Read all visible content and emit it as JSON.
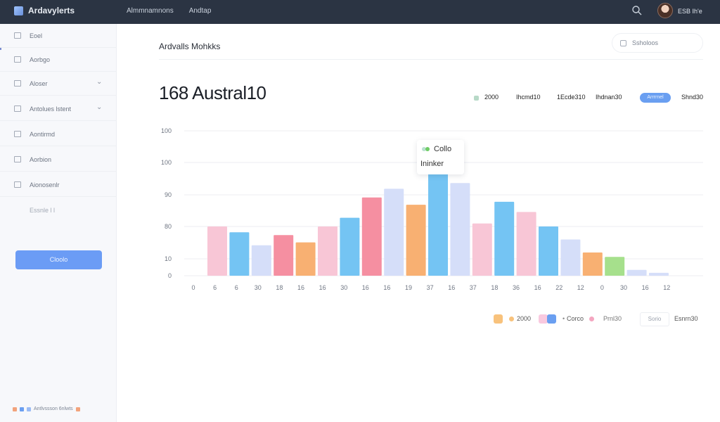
{
  "app": {
    "title": "Ardavylerts"
  },
  "topnav": {
    "items": [
      "Almmnamnons",
      "Andtap"
    ]
  },
  "user": {
    "name": "ESB Ih'e"
  },
  "sidebar": {
    "items": [
      {
        "label": "Eoel",
        "icon": "grid-icon",
        "chevron": false
      },
      {
        "label": "Aorbgo",
        "icon": "document-icon",
        "chevron": false
      },
      {
        "label": "Aloser",
        "icon": "bars-icon",
        "chevron": true
      },
      {
        "label": "Antolues lstent",
        "icon": "chart-icon",
        "chevron": true
      },
      {
        "label": "Aontirmd",
        "icon": "box-icon",
        "chevron": false
      },
      {
        "label": "Aorbion",
        "icon": "grid-icon",
        "chevron": false
      },
      {
        "label": "Aionosenlr",
        "icon": "layers-icon",
        "chevron": false
      }
    ],
    "note": "Essnle l l",
    "button_label": "Cloolo",
    "footer_label": "Antlvssson 6nlwts"
  },
  "main": {
    "section_title": "Ardvalls Mohkks",
    "filter_button": "Ssholoos",
    "headline": "168 Austral10"
  },
  "legend_top": {
    "items": [
      {
        "label": "2000",
        "color": "#b7d9c7"
      },
      {
        "label": "Ihcmd10",
        "color": "#2a2f38"
      },
      {
        "label": "1Ecde310",
        "color": "#ef8a4a"
      },
      {
        "label": "Ihdnan30",
        "color": "#e6587a"
      },
      {
        "label": "Arrrrnel",
        "color": "#6a9ff1"
      },
      {
        "label": "Shnd30",
        "color": "#4b5260"
      }
    ]
  },
  "tooltip": {
    "label": "Collo",
    "value": "Ininker"
  },
  "chart_data": {
    "type": "bar",
    "y_tick_labels": [
      "100",
      "100",
      "90",
      "80",
      "10",
      "0"
    ],
    "x_tick_labels": [
      "0",
      "6",
      "6",
      "30",
      "18",
      "16",
      "16",
      "30",
      "16",
      "16",
      "19",
      "37",
      "16",
      "37",
      "18",
      "36",
      "16",
      "22",
      "12",
      "0",
      "30",
      "16",
      "12"
    ],
    "ylim": [
      0,
      100
    ],
    "values": [
      34,
      30,
      21,
      28,
      23,
      34,
      40,
      54,
      60,
      49,
      73,
      64,
      36,
      51,
      44,
      34,
      25,
      16,
      13,
      4,
      2
    ],
    "colors": [
      "#f8c6d6",
      "#74c4f3",
      "#d5def9",
      "#f58fa1",
      "#f8b072",
      "#f8c6d6",
      "#74c4f3",
      "#f58fa1",
      "#d5def9",
      "#f8b072",
      "#74c4f3",
      "#d5def9",
      "#f8c6d6",
      "#74c4f3",
      "#f8c6d6",
      "#74c4f3",
      "#d5def9",
      "#f8b072",
      "#a6e08c",
      "#d5def9",
      "#d5def9"
    ],
    "grid": true
  },
  "legend_bottom": {
    "items": [
      {
        "label": "2000",
        "colors": [
          "#f8c27c",
          "#f8c27c"
        ]
      },
      {
        "label": "Corco",
        "colors": [
          "#f9c9df",
          "#6a9ff1"
        ]
      },
      {
        "label": "Prnl30",
        "colors": [
          "#f4a6c0"
        ]
      }
    ],
    "box_label": "Sorio",
    "last_label": "Esnrn30"
  }
}
